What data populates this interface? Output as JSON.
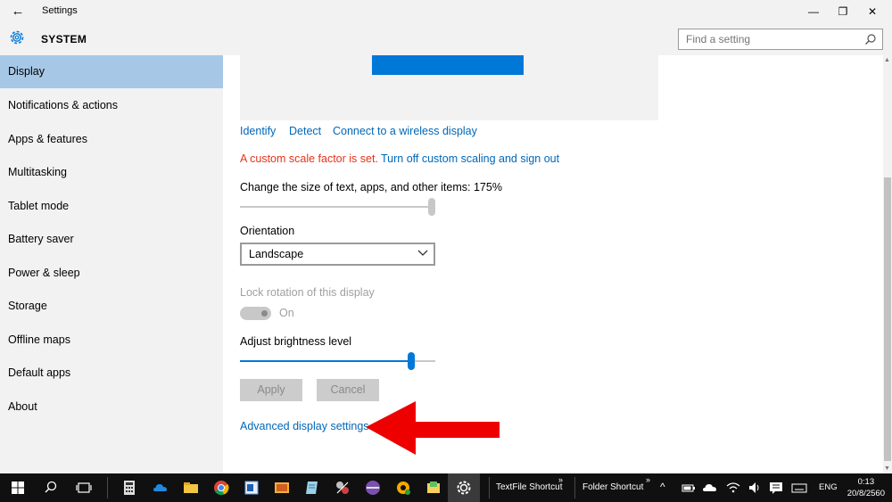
{
  "titlebar": {
    "back_icon": "back-arrow-icon",
    "title": "Settings",
    "minimize": "—",
    "restore": "❐",
    "close": "✕"
  },
  "header": {
    "section": "SYSTEM",
    "search_placeholder": "Find a setting"
  },
  "sidebar": {
    "items": [
      {
        "label": "Display",
        "active": true
      },
      {
        "label": "Notifications & actions"
      },
      {
        "label": "Apps & features"
      },
      {
        "label": "Multitasking"
      },
      {
        "label": "Tablet mode"
      },
      {
        "label": "Battery saver"
      },
      {
        "label": "Power & sleep"
      },
      {
        "label": "Storage"
      },
      {
        "label": "Offline maps"
      },
      {
        "label": "Default apps"
      },
      {
        "label": "About"
      }
    ]
  },
  "display": {
    "identify": "Identify",
    "detect": "Detect",
    "wireless": "Connect to a wireless display",
    "custom_scale_warning": "A custom scale factor is set.",
    "turn_off_scaling": "Turn off custom scaling and sign out",
    "scale_label": "Change the size of text, apps, and other items: 175%",
    "scale_slider_level": 1.0,
    "orientation_label": "Orientation",
    "orientation_value": "Landscape",
    "lock_rotation_label": "Lock rotation of this display",
    "lock_rotation_state": "On",
    "brightness_label": "Adjust brightness level",
    "brightness_level": 0.89,
    "apply": "Apply",
    "cancel": "Cancel",
    "advanced_link": "Advanced display settings"
  },
  "colors": {
    "accent": "#0078d7",
    "link": "#0067b8",
    "warning": "#e8321b",
    "active_nav": "#a6c8e6",
    "annotation_arrow": "#ee0000"
  },
  "taskbar": {
    "textfile_shortcut": "TextFile Shortcut",
    "folder_shortcut": "Folder Shortcut",
    "language": "ENG",
    "time": "0:13",
    "date": "20/8/2560"
  }
}
